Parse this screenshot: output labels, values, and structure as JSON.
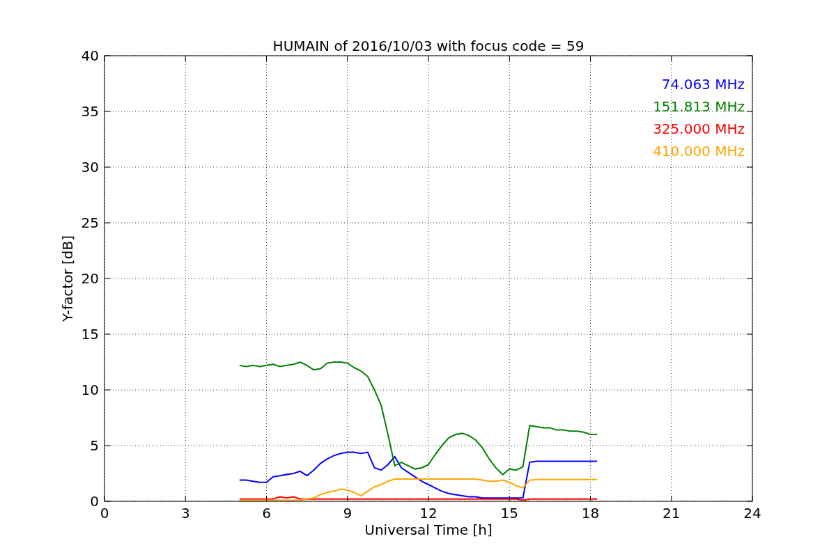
{
  "chart_data": {
    "type": "line",
    "title": "HUMAIN of 2016/10/03 with focus code = 59",
    "xlabel": "Universal Time [h]",
    "ylabel": "Y-factor [dB]",
    "xlim": [
      0,
      24
    ],
    "ylim": [
      0,
      40
    ],
    "xticks": [
      0,
      3,
      6,
      9,
      12,
      15,
      18,
      21,
      24
    ],
    "yticks": [
      0,
      5,
      10,
      15,
      20,
      25,
      30,
      35,
      40
    ],
    "grid": true,
    "x": [
      5,
      5.25,
      5.5,
      5.75,
      6,
      6.25,
      6.5,
      6.75,
      7,
      7.25,
      7.5,
      7.75,
      8,
      8.25,
      8.5,
      8.75,
      9,
      9.25,
      9.5,
      9.75,
      10,
      10.25,
      10.5,
      10.75,
      11,
      11.25,
      11.5,
      11.75,
      12,
      12.25,
      12.5,
      12.75,
      13,
      13.25,
      13.5,
      13.75,
      14,
      14.25,
      14.5,
      14.75,
      15,
      15.25,
      15.5,
      15.75,
      16,
      16.25,
      16.5,
      16.75,
      17,
      17.25,
      17.5,
      17.75,
      18,
      18.25
    ],
    "series": [
      {
        "name": "74.063 MHz",
        "color": "#0000ff",
        "values": [
          1.9,
          1.9,
          1.8,
          1.7,
          1.7,
          2.2,
          2.3,
          2.4,
          2.5,
          2.7,
          2.3,
          2.8,
          3.4,
          3.8,
          4.1,
          4.3,
          4.4,
          4.4,
          4.3,
          4.4,
          3.0,
          2.8,
          3.3,
          4.0,
          3.0,
          2.6,
          2.2,
          1.8,
          1.5,
          1.2,
          0.9,
          0.7,
          0.6,
          0.5,
          0.4,
          0.4,
          0.3,
          0.3,
          0.3,
          0.3,
          0.3,
          0.3,
          0.3,
          3.5,
          3.6,
          3.6,
          3.6,
          3.6,
          3.6,
          3.6,
          3.6,
          3.6,
          3.6,
          3.6
        ]
      },
      {
        "name": "151.813 MHz",
        "color": "#008000",
        "values": [
          12.2,
          12.1,
          12.2,
          12.1,
          12.2,
          12.3,
          12.1,
          12.2,
          12.3,
          12.5,
          12.2,
          11.8,
          11.9,
          12.4,
          12.5,
          12.5,
          12.4,
          12.0,
          11.7,
          11.2,
          10.0,
          8.6,
          6.0,
          3.2,
          3.5,
          3.2,
          2.9,
          3.0,
          3.3,
          4.2,
          5.0,
          5.7,
          6.0,
          6.1,
          5.9,
          5.5,
          4.8,
          3.8,
          3.0,
          2.4,
          2.9,
          2.8,
          3.1,
          6.8,
          6.7,
          6.6,
          6.6,
          6.4,
          6.4,
          6.3,
          6.3,
          6.2,
          6.0,
          6.0
        ]
      },
      {
        "name": "325.000 MHz",
        "color": "#ff0000",
        "values": [
          0.2,
          0.2,
          0.2,
          0.2,
          0.2,
          0.2,
          0.4,
          0.3,
          0.4,
          0.2,
          0.2,
          0.2,
          0.2,
          0.2,
          0.2,
          0.2,
          0.2,
          0.2,
          0.2,
          0.2,
          0.2,
          0.2,
          0.2,
          0.2,
          0.2,
          0.2,
          0.2,
          0.2,
          0.2,
          0.2,
          0.2,
          0.2,
          0.2,
          0.2,
          0.2,
          0.2,
          0.2,
          0.2,
          0.2,
          0.2,
          0.2,
          0.2,
          0.1,
          0.2,
          0.2,
          0.2,
          0.2,
          0.2,
          0.2,
          0.2,
          0.2,
          0.2,
          0.2,
          0.2
        ]
      },
      {
        "name": "410.000 MHz",
        "color": "#ffa500",
        "values": [
          0.1,
          0.1,
          0.1,
          0.1,
          0.1,
          0.1,
          0.1,
          0.1,
          0.1,
          0.1,
          0.2,
          0.3,
          0.6,
          0.8,
          0.9,
          1.1,
          1.0,
          0.8,
          0.5,
          0.9,
          1.3,
          1.5,
          1.8,
          2.0,
          2.0,
          2.0,
          2.0,
          2.0,
          2.0,
          2.0,
          2.0,
          2.0,
          2.0,
          2.0,
          2.0,
          2.0,
          1.9,
          1.8,
          1.8,
          1.9,
          1.7,
          1.4,
          1.2,
          1.9,
          1.95,
          1.95,
          1.95,
          1.95,
          1.95,
          1.95,
          1.95,
          1.95,
          1.95,
          1.95
        ]
      }
    ]
  }
}
